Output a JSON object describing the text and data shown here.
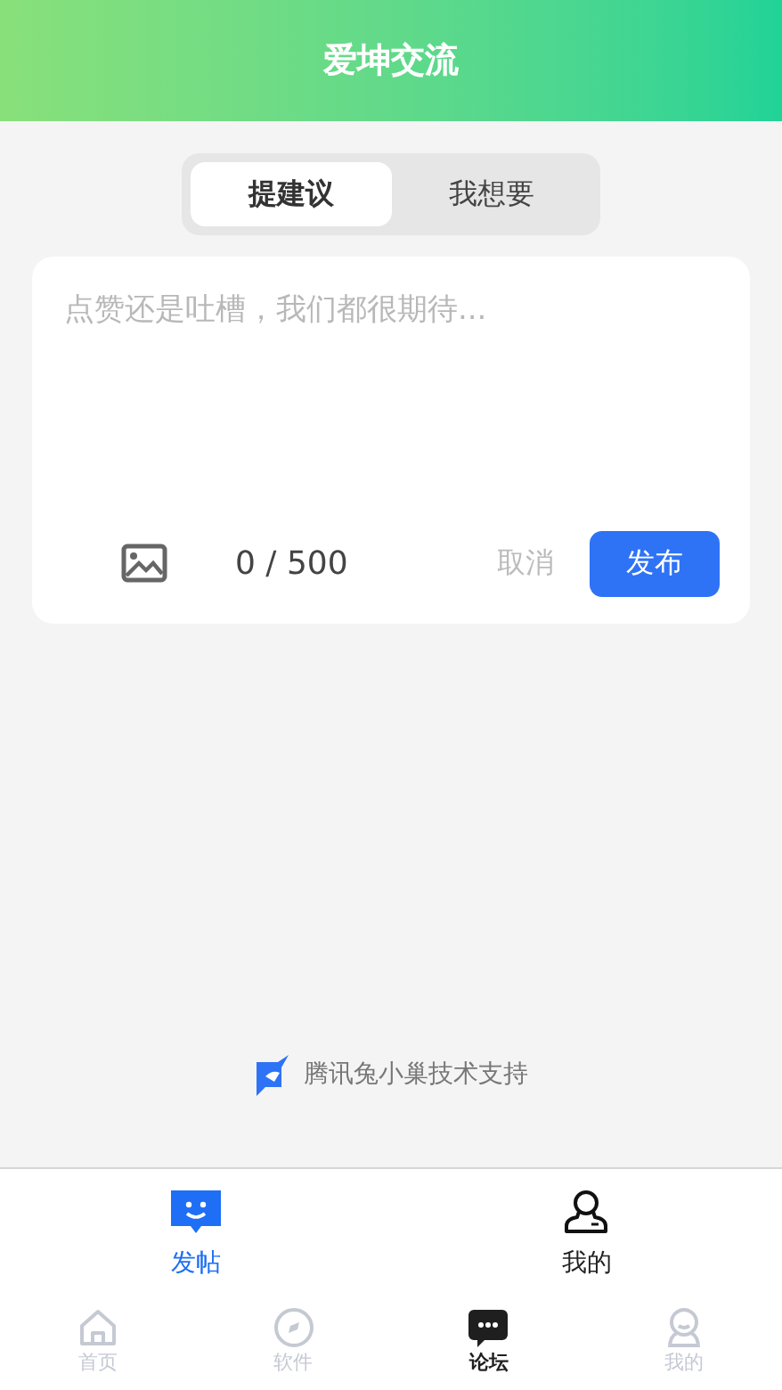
{
  "header": {
    "title": "爱坤交流"
  },
  "tabs": [
    {
      "label": "提建议",
      "selected": true
    },
    {
      "label": "我想要",
      "selected": false
    }
  ],
  "composer": {
    "placeholder": "点赞还是吐槽，我们都很期待...",
    "counter": "0 / 500",
    "cancel": "取消",
    "submit": "发布"
  },
  "credit": "腾讯兔小巢技术支持",
  "forum_tabs": [
    {
      "label": "发帖",
      "kind": "post",
      "selected": true
    },
    {
      "label": "我的",
      "kind": "user",
      "selected": false
    }
  ],
  "bottom_nav": [
    {
      "label": "首页",
      "kind": "home",
      "selected": false
    },
    {
      "label": "软件",
      "kind": "compass",
      "selected": false
    },
    {
      "label": "论坛",
      "kind": "chat",
      "selected": true
    },
    {
      "label": "我的",
      "kind": "face",
      "selected": false
    }
  ]
}
